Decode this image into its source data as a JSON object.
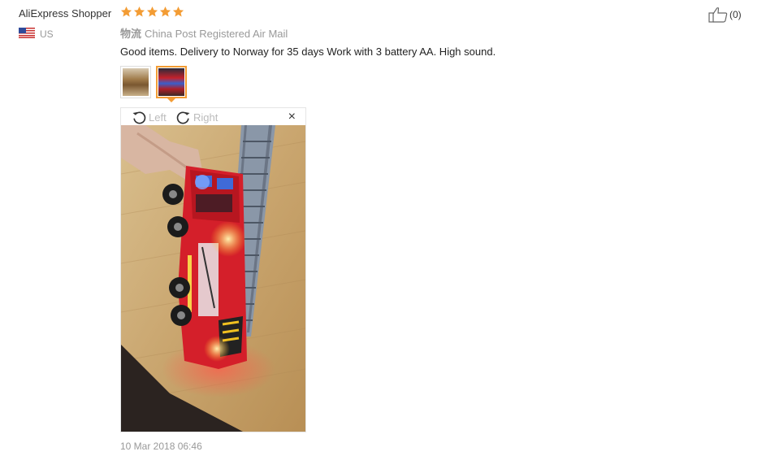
{
  "review": {
    "username": "AliExpress Shopper",
    "country": "US",
    "rating": 5,
    "stars": [
      1,
      2,
      3,
      4,
      5
    ],
    "logistics_label": "物流",
    "logistics_value": "China Post Registered Air Mail",
    "comment": "Good items. Delivery to Norway for 35 days Work with 3 battery AA. High sound.",
    "date": "10 Mar 2018 06:46",
    "helpful_count": "(0)"
  },
  "viewer": {
    "rotate_left_label": "Left",
    "rotate_right_label": "Right",
    "close_symbol": "×"
  },
  "colors": {
    "star": "#f39c34",
    "thumb_active_border": "#f39c34"
  }
}
